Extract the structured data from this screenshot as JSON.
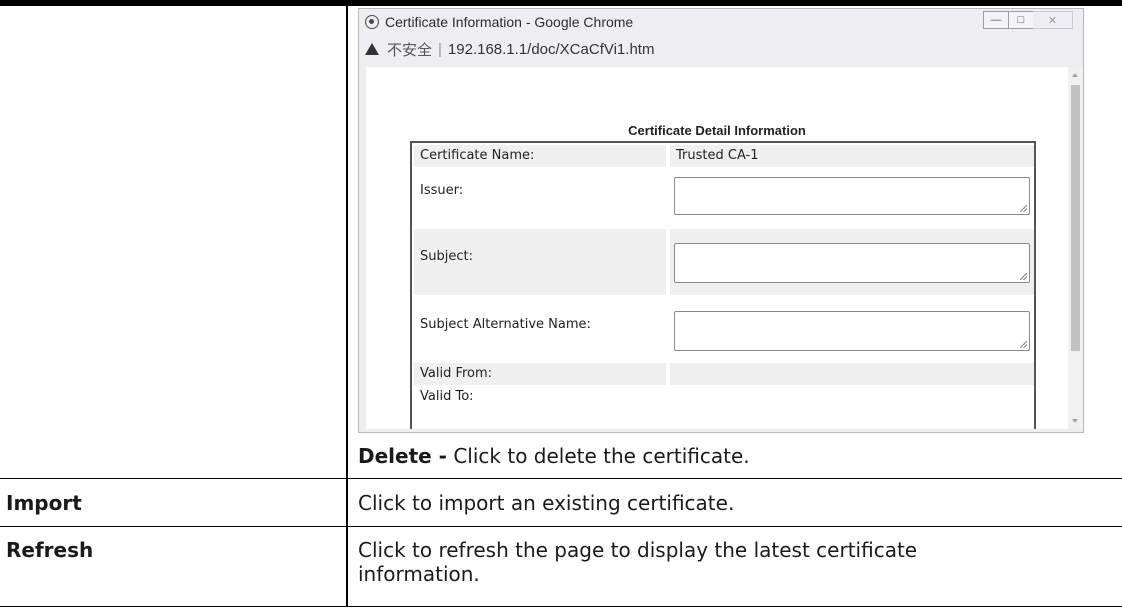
{
  "window": {
    "title": "Certificate Information - Google Chrome",
    "security_label": "不安全",
    "url": "192.168.1.1/doc/XCaCfVi1.htm"
  },
  "certificate": {
    "heading": "Certificate Detail Information",
    "rows": [
      {
        "label": "Certificate Name:",
        "value": "Trusted CA-1"
      },
      {
        "label": "Issuer:",
        "value": ""
      },
      {
        "label": "Subject:",
        "value": ""
      },
      {
        "label": "Subject Alternative Name:",
        "value": ""
      },
      {
        "label": "Valid From:",
        "value": ""
      },
      {
        "label": "Valid To:",
        "value": ""
      }
    ]
  },
  "doc": {
    "delete_term": "Delete -",
    "delete_desc": " Click to delete the certificate.",
    "import_label": "Import",
    "import_desc": "Click to import an existing certificate.",
    "refresh_label": "Refresh",
    "refresh_desc_line1": "Click to refresh the page to display the latest certificate",
    "refresh_desc_line2": "information."
  }
}
